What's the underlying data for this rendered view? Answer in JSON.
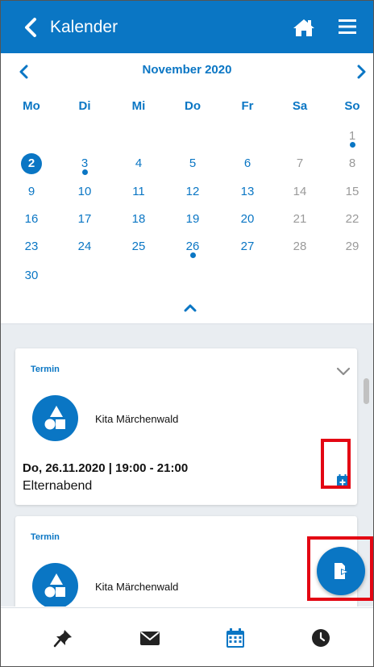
{
  "header": {
    "title": "Kalender",
    "back_icon": "chevron-left-icon",
    "home_icon": "home-icon",
    "menu_icon": "hamburger-menu-icon",
    "color": "#0a76c4"
  },
  "calendar": {
    "month_label": "November 2020",
    "weekdays": [
      "Mo",
      "Di",
      "Mi",
      "Do",
      "Fr",
      "Sa",
      "So"
    ],
    "days": [
      {
        "n": "1"
      },
      {
        "n": "2"
      },
      {
        "n": "3"
      },
      {
        "n": "4"
      },
      {
        "n": "5"
      },
      {
        "n": "6"
      },
      {
        "n": "7"
      },
      {
        "n": "8"
      },
      {
        "n": "9"
      },
      {
        "n": "10"
      },
      {
        "n": "11"
      },
      {
        "n": "12"
      },
      {
        "n": "13"
      },
      {
        "n": "14"
      },
      {
        "n": "15"
      },
      {
        "n": "16"
      },
      {
        "n": "17"
      },
      {
        "n": "18"
      },
      {
        "n": "19"
      },
      {
        "n": "20"
      },
      {
        "n": "21"
      },
      {
        "n": "22"
      },
      {
        "n": "23"
      },
      {
        "n": "24"
      },
      {
        "n": "25"
      },
      {
        "n": "26"
      },
      {
        "n": "27"
      },
      {
        "n": "28"
      },
      {
        "n": "29"
      },
      {
        "n": "30"
      }
    ],
    "selected_day": "2",
    "event_days": [
      "1",
      "3",
      "26"
    ]
  },
  "cards": [
    {
      "tag": "Termin",
      "organization": "Kita Märchenwald",
      "datetime": "Do, 26.11.2020 | 19:00 - 21:00",
      "title": "Elternabend"
    },
    {
      "tag": "Termin",
      "organization": "Kita Märchenwald"
    }
  ],
  "fab_icon": "export-file-icon",
  "bottom_nav": [
    {
      "icon": "pin-icon",
      "active": false
    },
    {
      "icon": "envelope-icon",
      "active": false
    },
    {
      "icon": "calendar-icon",
      "active": true
    },
    {
      "icon": "clock-icon",
      "active": false
    }
  ],
  "colors": {
    "accent": "#0a76c4",
    "weekend": "#9a9a9a",
    "highlight": "#e30613"
  }
}
